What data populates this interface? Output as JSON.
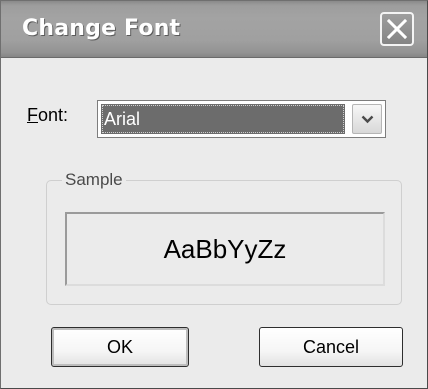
{
  "dialog": {
    "title": "Change Font",
    "close_icon": "close-icon"
  },
  "font_field": {
    "label_accel": "F",
    "label_rest": "ont:",
    "selected_value": "Arial",
    "dropdown_icon": "chevron-down-icon"
  },
  "sample_group": {
    "legend": "Sample",
    "preview_text": "AaBbYyZz"
  },
  "buttons": {
    "ok_label": "OK",
    "cancel_label": "Cancel"
  }
}
